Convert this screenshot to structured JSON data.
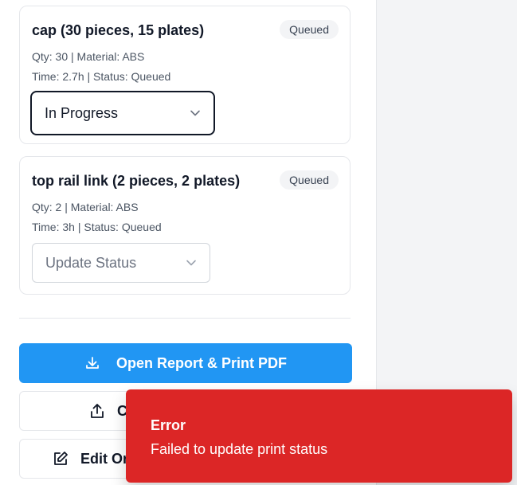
{
  "orders": [
    {
      "title": "cap (30 pieces, 15 plates)",
      "badge": "Queued",
      "meta_line1": "Qty: 30 | Material: ABS",
      "meta_line2": "Time: 2.7h | Status: Queued",
      "select_value": "In Progress"
    },
    {
      "title": "top rail link (2 pieces, 2 plates)",
      "badge": "Queued",
      "meta_line1": "Qty: 2 | Material: ABS",
      "meta_line2": "Time: 3h | Status: Queued",
      "select_placeholder": "Update Status"
    }
  ],
  "actions": {
    "open_report_label": "Open Report & Print PDF",
    "share_label": "C",
    "edit_label": "Edit Or"
  },
  "toast": {
    "title": "Error",
    "message": "Failed to update print status"
  },
  "colors": {
    "primary": "#2196f3",
    "error": "#dc2626"
  },
  "icons": {
    "select_chevron": "chevron-down-icon",
    "report": "download-icon",
    "share": "share-icon",
    "edit": "edit-icon"
  }
}
